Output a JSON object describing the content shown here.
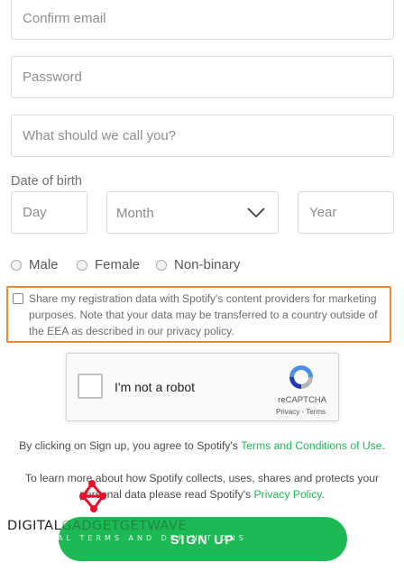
{
  "form": {
    "confirm_email_placeholder": "Confirm email",
    "password_placeholder": "Password",
    "nickname_placeholder": "What should we call you?",
    "dob_label": "Date of birth",
    "day_placeholder": "Day",
    "month_placeholder": "Month",
    "year_placeholder": "Year",
    "gender": {
      "male": "Male",
      "female": "Female",
      "nonbinary": "Non-binary"
    },
    "share_data_text": "Share my registration data with Spotify's content providers for marketing purposes. Note that your data may be transferred to a country outside of the EEA as described in our privacy policy."
  },
  "recaptcha": {
    "label": "I'm not a robot",
    "brand": "reCAPTCHA",
    "privacy": "Privacy",
    "terms": "Terms"
  },
  "legal": {
    "terms_prefix": "By clicking on Sign up, you agree to Spotify's",
    "terms_link": "Terms and Conditions of Use",
    "terms_suffix": ".",
    "privacy_prefix": "To learn more about how Spotify collects, uses, shares and protects your personal data please read Spotify's",
    "privacy_link": "Privacy Policy",
    "privacy_suffix": "."
  },
  "signup_label": "SIGN UP",
  "watermark": {
    "title_dark": "DIGITAL",
    "title_light": "GADGETGETWAVE",
    "subtitle": "AL TERMS AND DEFINITIONS"
  },
  "colors": {
    "accent": "#1db954",
    "highlight_border": "#e98a3b",
    "watermark_red": "#e8102a"
  },
  "icons": {
    "month_dropdown": "chevron-down-icon",
    "recaptcha": "recaptcha-logo-icon",
    "watermark": "network-logo-icon"
  }
}
